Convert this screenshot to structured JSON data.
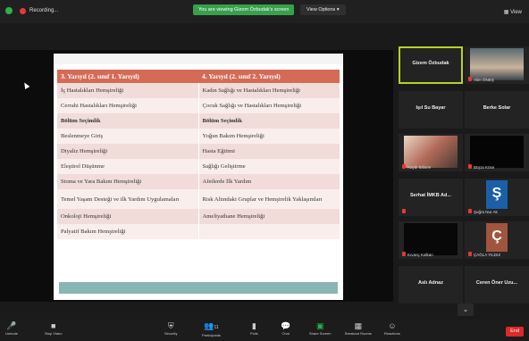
{
  "topbar": {
    "recording": "Recording...",
    "viewing_banner": "You are viewing Gizem Özbudak's screen",
    "view_options": "View Options ▾",
    "view_button": "View"
  },
  "slide": {
    "headers": [
      "3. Yarıyıl (2. sınıf 1. Yarıyıl)",
      "4. Yarıyıl (2. sınıf 2. Yarıyıl)"
    ],
    "rows": [
      [
        "İç Hastalıkları Hemşireliği",
        "Kadın Sağlığı ve Hastalıkları Hemşireliği"
      ],
      [
        "Cerrahi Hastalıkları Hemşireliği",
        "Çocuk Sağlığı ve Hastalıkları Hemşireliği"
      ],
      [
        "Bölüm Seçimlik",
        "Bölüm Seçimlik"
      ],
      [
        "Beslenmeye Giriş",
        "Yoğun Bakım Hemşireliği"
      ],
      [
        "Diyaliz Hemşireliği",
        "Hasta Eğitimi"
      ],
      [
        "Eleştirel Düşünme",
        "Sağlığı Geliştirme"
      ],
      [
        "Stoma ve Yara Bakım Hemşireliği",
        "Afetlerde İlk Yardım"
      ],
      [
        "Temel Yaşam Desteği ve ilk Yardım Uygulamaları",
        "Risk Altındaki Gruplar ve Hemşirelik Yaklaşımları"
      ],
      [
        "Onkoloji Hemşireliği",
        "Ameliyathane Hemşireliği"
      ],
      [
        "Palyatif Bakım Hemşireliği",
        ""
      ]
    ]
  },
  "participants": [
    {
      "name": "Gizem Özbudak",
      "label": ""
    },
    {
      "name": "",
      "label": "Alim ÖNEŞ"
    },
    {
      "name": "Işıl Su Bayar",
      "label": ""
    },
    {
      "name": "Berke Solar",
      "label": ""
    },
    {
      "name": "",
      "label": "Kaydı Bilinen"
    },
    {
      "name": "",
      "label": "Büşra Köse"
    },
    {
      "name": "Serhat İMKB Ad...",
      "label": ""
    },
    {
      "name": "",
      "label": "Şuğra Nur Ak"
    },
    {
      "name": "",
      "label": "Kıvanç Kalkan"
    },
    {
      "name": "",
      "label": "ÇAĞLA YILDIZ"
    },
    {
      "name": "Aslı Adnaz",
      "label": ""
    },
    {
      "name": "Ceren Öner Uzu...",
      "label": ""
    }
  ],
  "logos": {
    "s": "Ş",
    "c": "Ç"
  },
  "toolbar": {
    "unmute": "Unmute",
    "stop_video": "Stop Video",
    "security": "Security",
    "participants": "Participants",
    "participants_count": "11",
    "polls": "Polls",
    "chat": "Chat",
    "share_screen": "Share Screen",
    "breakout": "Breakout Rooms",
    "reactions": "Reactions",
    "end": "End"
  },
  "colors": {
    "header": "#d46b57",
    "row_a": "#f1dcd9",
    "row_b": "#f9eeec",
    "active_speaker": "#b5d41f",
    "banner": "#36a14a",
    "end": "#e02828"
  }
}
